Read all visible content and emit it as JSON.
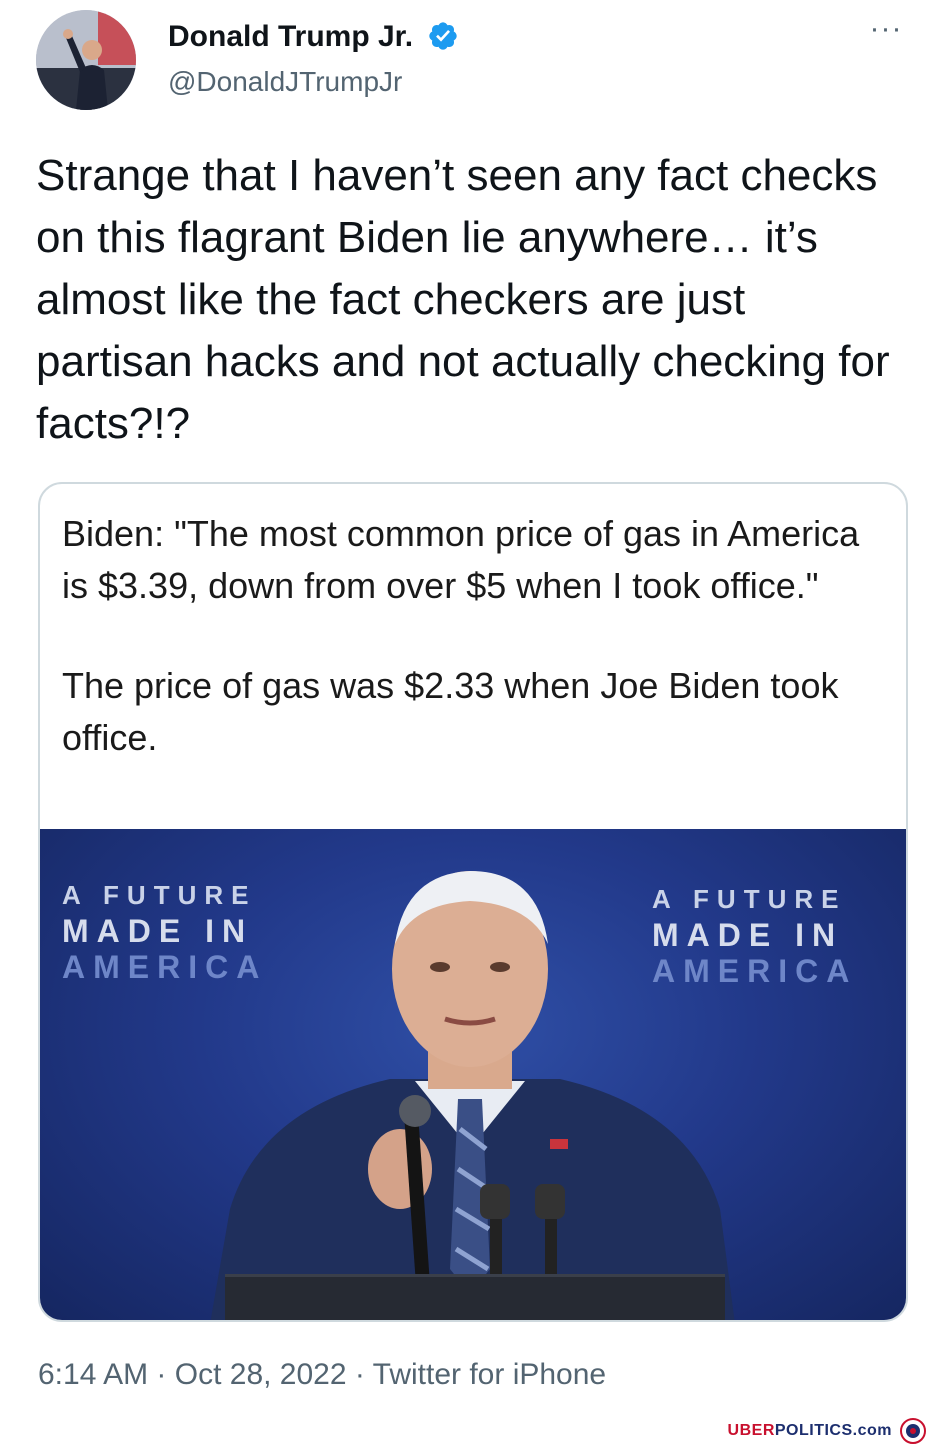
{
  "author": {
    "name": "Donald Trump Jr.",
    "handle": "@DonaldJTrumpJr",
    "verified_icon": "verified-badge-icon",
    "accent_color": "#1d9bf0"
  },
  "tweet": {
    "text": "Strange that I haven’t seen any fact checks on this flagrant Biden lie anywhere… it’s almost like the fact checkers are just partisan hacks and not actually checking for facts?!?",
    "more_icon": "more-options-icon"
  },
  "card": {
    "paragraph1": "Biden: \"The most common price of gas in America is $3.39, down from over $5 when I took office.\"",
    "paragraph2": "The price of gas was $2.33 when Joe Biden took office.",
    "banner_left": {
      "line1": "A FUTURE",
      "line2": "MADE IN",
      "line3": "AMERICA"
    },
    "banner_right": {
      "line1": "A FUTURE",
      "line2": "MADE IN",
      "line3": "AMERICA"
    }
  },
  "meta": {
    "time": "6:14 AM",
    "separator": " · ",
    "date": "Oct 28, 2022",
    "source": "Twitter for iPhone"
  },
  "watermark": {
    "part1": "UBER",
    "part2": "POLITICS.com"
  }
}
